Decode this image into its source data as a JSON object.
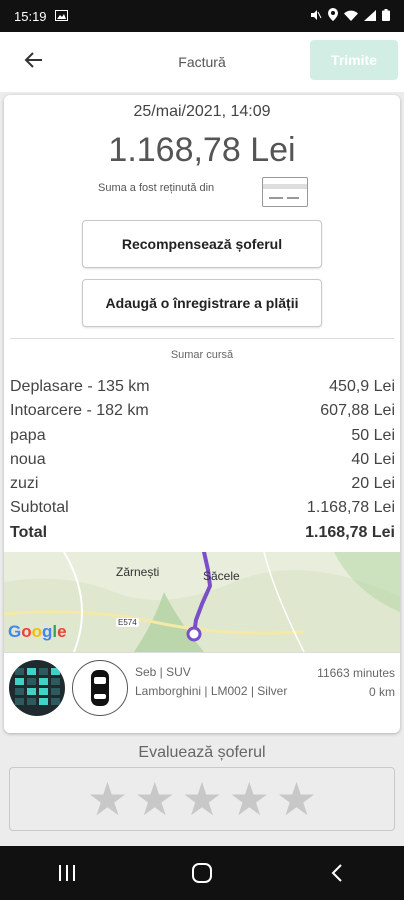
{
  "status_bar": {
    "time": "15:19"
  },
  "header": {
    "title": "Factură",
    "send_label": "Trimite"
  },
  "invoice": {
    "date": "25/mai/2021, 14:09",
    "amount": "1.168,78 Lei",
    "retained_text": "Suma a fost reținută din",
    "tip_driver_label": "Recompensează șoferul",
    "add_payment_label": "Adaugă o înregistrare a plății"
  },
  "summary": {
    "title": "Sumar cursă",
    "rows": [
      {
        "label": "Deplasare - 135 km",
        "value": "450,9 Lei"
      },
      {
        "label": "Intoarcere - 182 km",
        "value": "607,88 Lei"
      },
      {
        "label": "papa",
        "value": "50 Lei"
      },
      {
        "label": "noua",
        "value": "40 Lei"
      },
      {
        "label": "zuzi",
        "value": "20 Lei"
      },
      {
        "label": "Subtotal",
        "value": "1.168,78 Lei"
      },
      {
        "label": "Total",
        "value": "1.168,78 Lei"
      }
    ]
  },
  "map": {
    "place1": "Zărnești",
    "place2": "Săcele",
    "road": "E574",
    "google": [
      {
        "ch": "G",
        "color": "#4285F4"
      },
      {
        "ch": "o",
        "color": "#EA4335"
      },
      {
        "ch": "o",
        "color": "#FBBC05"
      },
      {
        "ch": "g",
        "color": "#4285F4"
      },
      {
        "ch": "l",
        "color": "#34A853"
      },
      {
        "ch": "e",
        "color": "#EA4335"
      }
    ],
    "route_color": "#7b4fc9"
  },
  "driver": {
    "line1": "Seb | SUV",
    "line2": "Lamborghini | LM002 | Silver",
    "duration": "11663 minutes",
    "distance": "0 km"
  },
  "rating": {
    "title": "Evaluează șoferul",
    "stars": 5,
    "selected": 0
  },
  "colors": {
    "accent": "#d2ede4",
    "star": "#c8c8c8"
  }
}
